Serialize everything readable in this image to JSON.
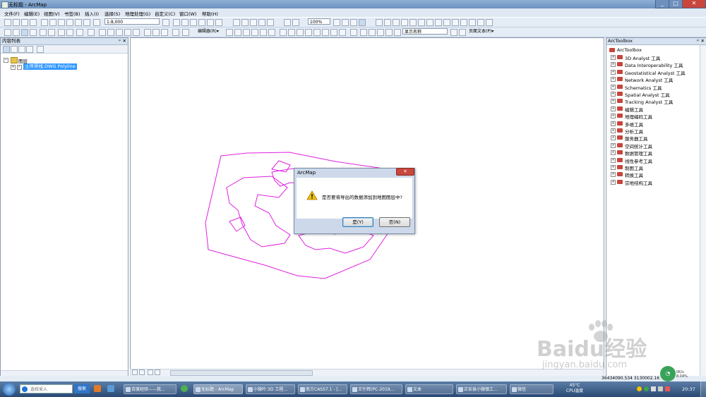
{
  "window": {
    "title": "无标题 - ArcMap"
  },
  "menu": [
    "文件(F)",
    "编辑(E)",
    "视图(V)",
    "书签(B)",
    "插入(I)",
    "选择(S)",
    "地理处理(G)",
    "自定义(C)",
    "窗口(W)",
    "帮助(H)"
  ],
  "toolbar": {
    "scale_value": "1:8,000",
    "zoom_value": "100%",
    "editor_label": "编辑器(R)▾",
    "display_name": "显示名称",
    "page_text": "页面文本(P)▾"
  },
  "toc": {
    "title": "内容列表",
    "group_label": "图层",
    "layer_label": "土坪界线.DWG Polyline"
  },
  "toolbox": {
    "title": "ArcToolbox",
    "root_label": "ArcToolbox",
    "items": [
      "3D Analyst 工具",
      "Data Interoperability 工具",
      "Geostatistical Analyst 工具",
      "Network Analyst 工具",
      "Schematics 工具",
      "Spatial Analyst 工具",
      "Tracking Analyst 工具",
      "编辑工具",
      "地理编码工具",
      "多维工具",
      "分析工具",
      "服务器工具",
      "空间统计工具",
      "数据管理工具",
      "线性参考工具",
      "制图工具",
      "转换工具",
      "宗地结构工具"
    ]
  },
  "dialog": {
    "title": "ArcMap",
    "message": "是否要将导出的数据添加到地图图层中?",
    "yes_label": "是(Y)",
    "no_label": "否(N)"
  },
  "status": {
    "coordinates": "36434090.534  3130002.16"
  },
  "taskbar": {
    "search_placeholder": "选校采入",
    "search_button": "搜索",
    "tasks": [
      "百度经验——我...",
      "无标题 - ArcMap",
      "小微叶:3D 工程...",
      "南方CASS7.1 - [...",
      "王什辉(PC-2019...",
      "文本",
      "正安县小微镇工...",
      "微信"
    ],
    "temperature": "45°C",
    "cpu_label": "CPU温度",
    "network_rate": "0K/s",
    "cpu_percent": "8.04%",
    "clock": "20:37",
    "active_task_index": 1
  },
  "watermark": {
    "brand": "Baidu经验",
    "url": "jingyan.baidu.com"
  },
  "colors": {
    "polyline": "#e020e0",
    "selection": "#3399ff",
    "warning": "#f2c200"
  }
}
